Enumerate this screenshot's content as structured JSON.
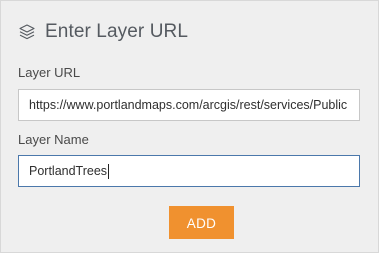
{
  "header": {
    "title": "Enter Layer URL",
    "icon": "layers-icon"
  },
  "layer_url": {
    "label": "Layer URL",
    "value": "https://www.portlandmaps.com/arcgis/rest/services/Public"
  },
  "layer_name": {
    "label": "Layer Name",
    "value": "PortlandTrees"
  },
  "actions": {
    "add_label": "ADD"
  },
  "colors": {
    "panel_bg": "#efefef",
    "button_accent": "#f0912f",
    "focus_border": "#4b78ab"
  }
}
